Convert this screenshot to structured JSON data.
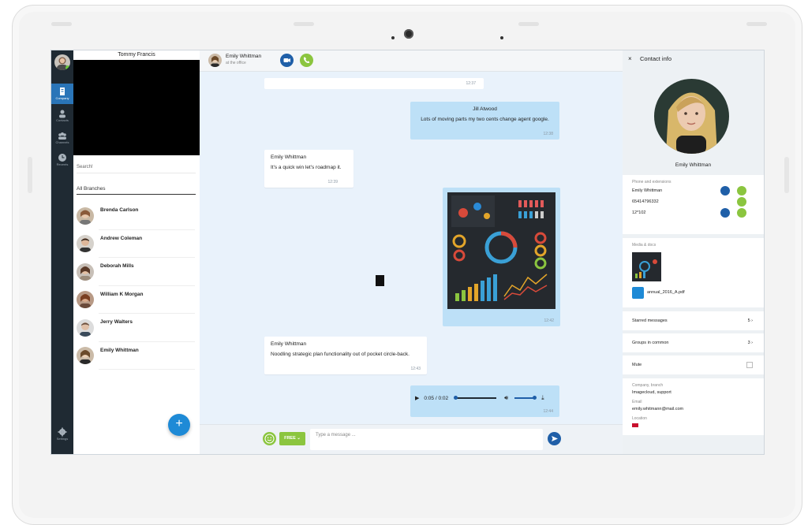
{
  "nav": {
    "items": [
      {
        "label": "Company",
        "icon": "company-icon",
        "active": true
      },
      {
        "label": "Contacts",
        "icon": "contacts-icon"
      },
      {
        "label": "Channels",
        "icon": "channels-icon"
      },
      {
        "label": "Recents",
        "icon": "recents-icon"
      }
    ],
    "settings_label": "Settings"
  },
  "contacts": {
    "caller_name": "Tommy Francis",
    "search_placeholder": "Search!",
    "branch_filter": "All Branches",
    "list": [
      {
        "name": "Brenda Carlson"
      },
      {
        "name": "Andrew Coleman"
      },
      {
        "name": "Deborah Mills"
      },
      {
        "name": "William K Morgan"
      },
      {
        "name": "Jerry Walters"
      },
      {
        "name": "Emily Whittman"
      }
    ],
    "add_symbol": "+"
  },
  "chat": {
    "name": "Emily Whittman",
    "status": "at the office",
    "messages": [
      {
        "time": "12:37"
      },
      {
        "sender": "Jill Atwood",
        "text": "Lots of moving parts my two cents change agent google.",
        "time": "12:38"
      },
      {
        "sender": "Emily Whittman",
        "text": "It's a quick win let's roadmap it.",
        "time": "12:39"
      },
      {
        "time": "12:42"
      },
      {
        "sender": "Emily Whittman",
        "text": "Noodling strategic plan functionality out of pocket circle-back.",
        "time": "12:43"
      },
      {
        "audio": "0:05 / 0:02",
        "time": "12:44"
      }
    ],
    "composer": {
      "free_label": "FREE",
      "placeholder": "Type a message ..."
    }
  },
  "contact_info": {
    "title": "Contact info",
    "close_symbol": "×",
    "name": "Emily Whittman",
    "phone_label": "Phone and extensions",
    "phones": [
      "Emily Whittman",
      "65414796332",
      "12*102"
    ],
    "media_label": "Media & docs",
    "doc_name": "annual_2016_A.pdf",
    "starred_label": "Starred messages",
    "starred_count": "5 ›",
    "groups_label": "Groups in common",
    "groups_count": "3 ›",
    "mute_label": "Mute",
    "company_label": "Company, branch",
    "company_value": "Imagecloud, support",
    "email_label": "Email",
    "email_value": "emily.whitmann@mail.com",
    "location_label": "Location"
  },
  "colors": {
    "accent": "#2a75b8",
    "green": "#8bc53f",
    "bubble_out": "#bde0f7",
    "chat_bg": "#e9f2fb",
    "rail": "#1f2a33"
  }
}
